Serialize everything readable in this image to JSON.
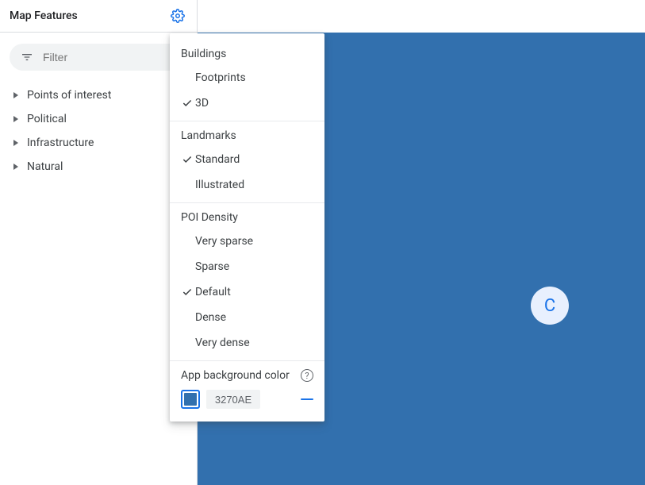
{
  "sidebar": {
    "title": "Map Features",
    "filter_placeholder": "Filter",
    "items": [
      {
        "label": "Points of interest"
      },
      {
        "label": "Political"
      },
      {
        "label": "Infrastructure"
      },
      {
        "label": "Natural"
      }
    ]
  },
  "popup": {
    "sections": [
      {
        "title": "Buildings",
        "options": [
          {
            "label": "Footprints",
            "selected": false
          },
          {
            "label": "3D",
            "selected": true
          }
        ]
      },
      {
        "title": "Landmarks",
        "options": [
          {
            "label": "Standard",
            "selected": true
          },
          {
            "label": "Illustrated",
            "selected": false
          }
        ]
      },
      {
        "title": "POI Density",
        "options": [
          {
            "label": "Very sparse",
            "selected": false
          },
          {
            "label": "Sparse",
            "selected": false
          },
          {
            "label": "Default",
            "selected": true
          },
          {
            "label": "Dense",
            "selected": false
          },
          {
            "label": "Very dense",
            "selected": false
          }
        ]
      }
    ],
    "bg": {
      "title": "App background color",
      "hex": "3270AE",
      "color": "#3270AE"
    }
  },
  "canvas": {
    "background": "#3270AE",
    "avatar_letter": "C",
    "avatar_color": "#1a73e8"
  }
}
